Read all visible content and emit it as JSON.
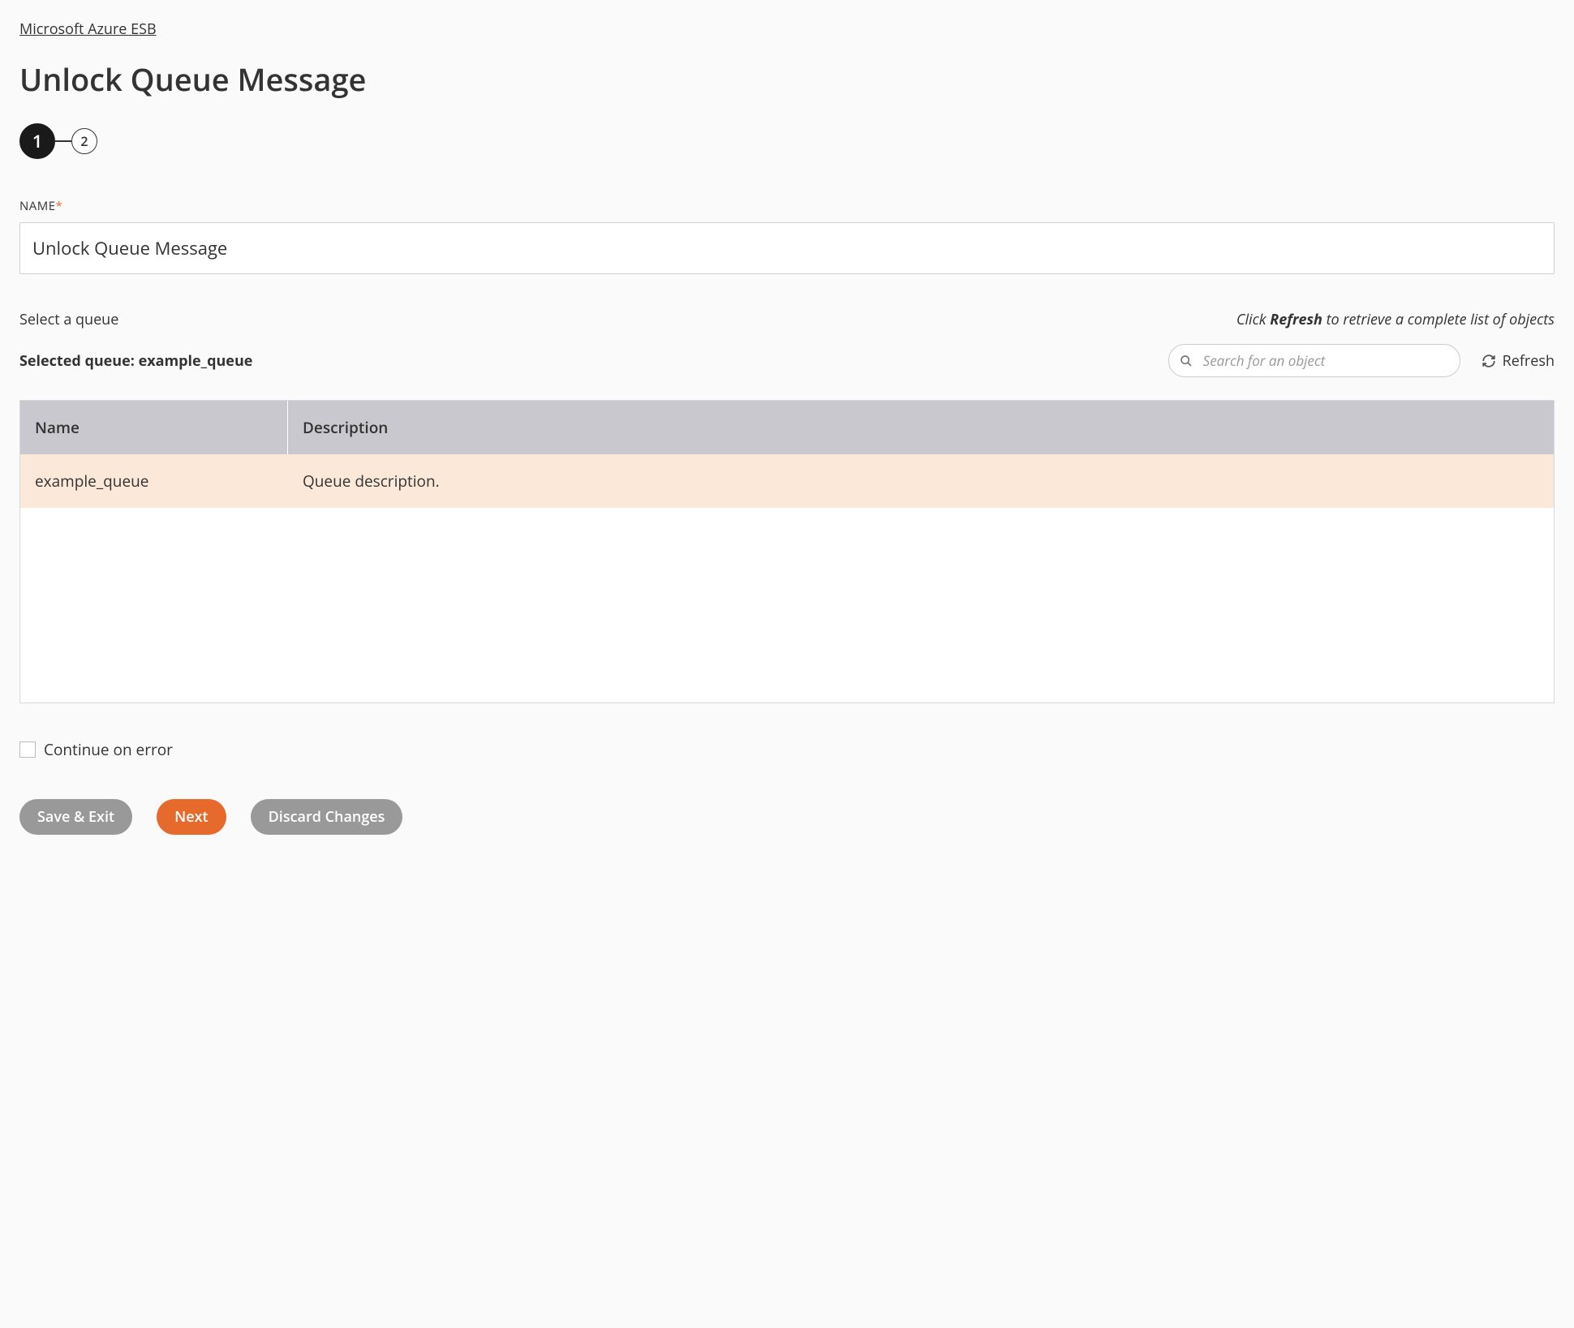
{
  "breadcrumb": "Microsoft Azure ESB",
  "page_title": "Unlock Queue Message",
  "stepper": {
    "current": "1",
    "next": "2"
  },
  "name_field": {
    "label": "NAME",
    "value": "Unlock Queue Message"
  },
  "queue_section": {
    "select_label": "Select a queue",
    "hint_prefix": "Click ",
    "hint_bold": "Refresh",
    "hint_suffix": " to retrieve a complete list of objects",
    "selected_prefix": "Selected queue: ",
    "selected_value": "example_queue",
    "search_placeholder": "Search for an object",
    "refresh_label": "Refresh"
  },
  "table": {
    "headers": {
      "name": "Name",
      "description": "Description"
    },
    "rows": [
      {
        "name": "example_queue",
        "description": "Queue description."
      }
    ]
  },
  "continue_on_error_label": "Continue on error",
  "buttons": {
    "save_exit": "Save & Exit",
    "next": "Next",
    "discard": "Discard Changes"
  }
}
